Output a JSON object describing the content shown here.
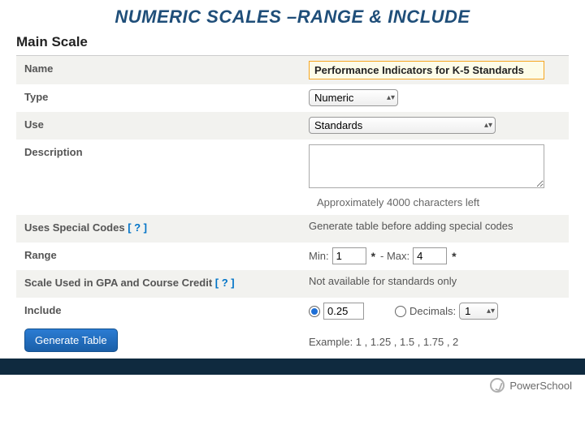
{
  "title": "NUMERIC SCALES –RANGE & INCLUDE",
  "section": "Main Scale",
  "fields": {
    "name": {
      "label": "Name",
      "value": "Performance Indicators for K-5 Standards"
    },
    "type": {
      "label": "Type",
      "value": "Numeric"
    },
    "use": {
      "label": "Use",
      "value": "Standards"
    },
    "description": {
      "label": "Description",
      "value": "",
      "chars_left": "Approximately 4000 characters left"
    },
    "special_codes": {
      "label": "Uses Special Codes",
      "help": "[ ? ]",
      "message": "Generate table before adding special codes"
    },
    "range": {
      "label": "Range",
      "min_label": "Min:",
      "min": "1",
      "max_label": "- Max:",
      "max": "4"
    },
    "gpa": {
      "label": "Scale Used in GPA and Course Credit",
      "help": "[ ? ]",
      "message": "Not available for standards only"
    },
    "include": {
      "label": "Include",
      "step": "0.25",
      "decimals_label": "Decimals:",
      "decimals": "1",
      "example": "Example: 1 , 1.25 , 1.5 , 1.75 , 2"
    }
  },
  "buttons": {
    "generate": "Generate Table"
  },
  "brand": "PowerSchool"
}
